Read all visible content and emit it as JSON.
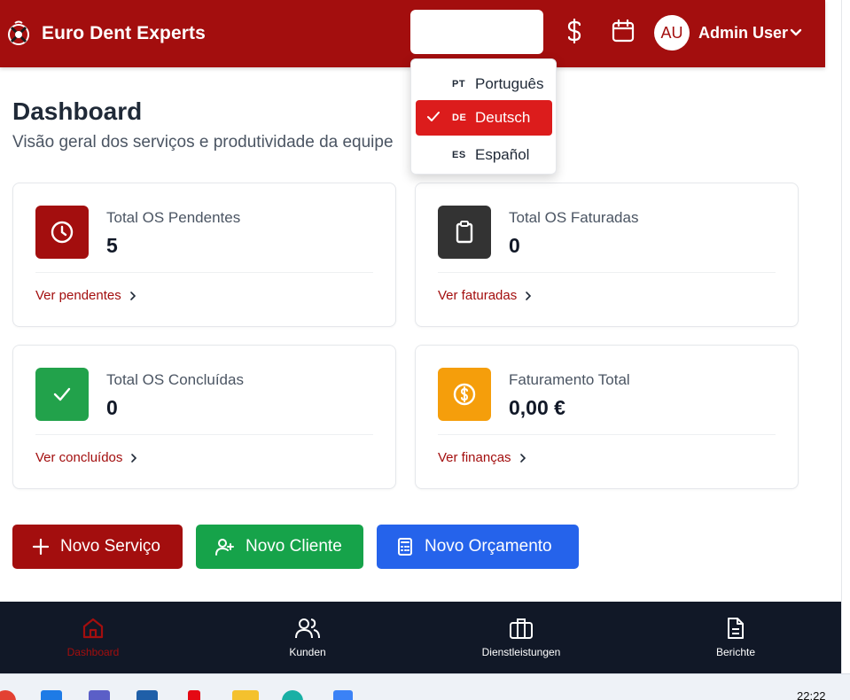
{
  "header": {
    "brand": "Euro Dent Experts",
    "user_initials": "AU",
    "user_name": "Admin User"
  },
  "language_menu": {
    "options": [
      {
        "code": "PT",
        "label": "Português",
        "selected": false
      },
      {
        "code": "DE",
        "label": "Deutsch",
        "selected": true
      },
      {
        "code": "ES",
        "label": "Español",
        "selected": false
      }
    ]
  },
  "page": {
    "title": "Dashboard",
    "subtitle": "Visão geral dos serviços e produtividade da equipe"
  },
  "cards": [
    {
      "label": "Total OS Pendentes",
      "value": "5",
      "link": "Ver pendentes",
      "icon": "clock-icon",
      "color": "#a30e0e"
    },
    {
      "label": "Total OS Faturadas",
      "value": "0",
      "link": "Ver faturadas",
      "icon": "clipboard-icon",
      "color": "#333333"
    },
    {
      "label": "Total OS Concluídas",
      "value": "0",
      "link": "Ver concluídos",
      "icon": "check-icon",
      "color": "#22a24b"
    },
    {
      "label": "Faturamento Total",
      "value": "0,00 €",
      "link": "Ver finanças",
      "icon": "dollar-coin-icon",
      "color": "#f59e0b"
    }
  ],
  "actions": [
    {
      "label": "Novo Serviço",
      "icon": "plus-icon",
      "color": "#a30e0e"
    },
    {
      "label": "Novo Cliente",
      "icon": "user-plus-icon",
      "color": "#16a34a"
    },
    {
      "label": "Novo Orçamento",
      "icon": "calculator-icon",
      "color": "#2563eb"
    }
  ],
  "bottom_nav": [
    {
      "label": "Dashboard",
      "icon": "home-icon",
      "active": true
    },
    {
      "label": "Kunden",
      "icon": "users-icon",
      "active": false
    },
    {
      "label": "Dienstleistungen",
      "icon": "briefcase-icon",
      "active": false
    },
    {
      "label": "Berichte",
      "icon": "document-icon",
      "active": false
    }
  ],
  "taskbar": {
    "time": "22:22"
  },
  "colors": {
    "brand": "#a30e0e",
    "selected_option": "#dc1c1c",
    "nav_background": "#111827"
  }
}
